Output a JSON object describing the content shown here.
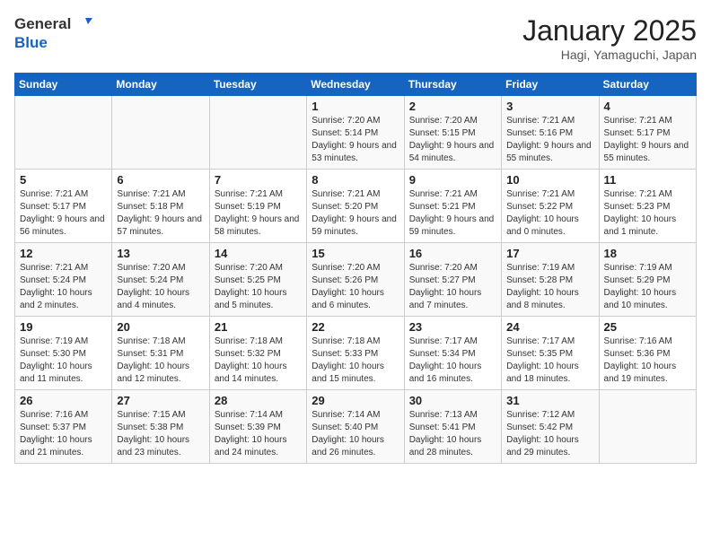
{
  "header": {
    "logo_line1": "General",
    "logo_line2": "Blue",
    "title": "January 2025",
    "subtitle": "Hagi, Yamaguchi, Japan"
  },
  "days_of_week": [
    "Sunday",
    "Monday",
    "Tuesday",
    "Wednesday",
    "Thursday",
    "Friday",
    "Saturday"
  ],
  "weeks": [
    [
      {
        "day": "",
        "info": ""
      },
      {
        "day": "",
        "info": ""
      },
      {
        "day": "",
        "info": ""
      },
      {
        "day": "1",
        "info": "Sunrise: 7:20 AM\nSunset: 5:14 PM\nDaylight: 9 hours and 53 minutes."
      },
      {
        "day": "2",
        "info": "Sunrise: 7:20 AM\nSunset: 5:15 PM\nDaylight: 9 hours and 54 minutes."
      },
      {
        "day": "3",
        "info": "Sunrise: 7:21 AM\nSunset: 5:16 PM\nDaylight: 9 hours and 55 minutes."
      },
      {
        "day": "4",
        "info": "Sunrise: 7:21 AM\nSunset: 5:17 PM\nDaylight: 9 hours and 55 minutes."
      }
    ],
    [
      {
        "day": "5",
        "info": "Sunrise: 7:21 AM\nSunset: 5:17 PM\nDaylight: 9 hours and 56 minutes."
      },
      {
        "day": "6",
        "info": "Sunrise: 7:21 AM\nSunset: 5:18 PM\nDaylight: 9 hours and 57 minutes."
      },
      {
        "day": "7",
        "info": "Sunrise: 7:21 AM\nSunset: 5:19 PM\nDaylight: 9 hours and 58 minutes."
      },
      {
        "day": "8",
        "info": "Sunrise: 7:21 AM\nSunset: 5:20 PM\nDaylight: 9 hours and 59 minutes."
      },
      {
        "day": "9",
        "info": "Sunrise: 7:21 AM\nSunset: 5:21 PM\nDaylight: 9 hours and 59 minutes."
      },
      {
        "day": "10",
        "info": "Sunrise: 7:21 AM\nSunset: 5:22 PM\nDaylight: 10 hours and 0 minutes."
      },
      {
        "day": "11",
        "info": "Sunrise: 7:21 AM\nSunset: 5:23 PM\nDaylight: 10 hours and 1 minute."
      }
    ],
    [
      {
        "day": "12",
        "info": "Sunrise: 7:21 AM\nSunset: 5:24 PM\nDaylight: 10 hours and 2 minutes."
      },
      {
        "day": "13",
        "info": "Sunrise: 7:20 AM\nSunset: 5:24 PM\nDaylight: 10 hours and 4 minutes."
      },
      {
        "day": "14",
        "info": "Sunrise: 7:20 AM\nSunset: 5:25 PM\nDaylight: 10 hours and 5 minutes."
      },
      {
        "day": "15",
        "info": "Sunrise: 7:20 AM\nSunset: 5:26 PM\nDaylight: 10 hours and 6 minutes."
      },
      {
        "day": "16",
        "info": "Sunrise: 7:20 AM\nSunset: 5:27 PM\nDaylight: 10 hours and 7 minutes."
      },
      {
        "day": "17",
        "info": "Sunrise: 7:19 AM\nSunset: 5:28 PM\nDaylight: 10 hours and 8 minutes."
      },
      {
        "day": "18",
        "info": "Sunrise: 7:19 AM\nSunset: 5:29 PM\nDaylight: 10 hours and 10 minutes."
      }
    ],
    [
      {
        "day": "19",
        "info": "Sunrise: 7:19 AM\nSunset: 5:30 PM\nDaylight: 10 hours and 11 minutes."
      },
      {
        "day": "20",
        "info": "Sunrise: 7:18 AM\nSunset: 5:31 PM\nDaylight: 10 hours and 12 minutes."
      },
      {
        "day": "21",
        "info": "Sunrise: 7:18 AM\nSunset: 5:32 PM\nDaylight: 10 hours and 14 minutes."
      },
      {
        "day": "22",
        "info": "Sunrise: 7:18 AM\nSunset: 5:33 PM\nDaylight: 10 hours and 15 minutes."
      },
      {
        "day": "23",
        "info": "Sunrise: 7:17 AM\nSunset: 5:34 PM\nDaylight: 10 hours and 16 minutes."
      },
      {
        "day": "24",
        "info": "Sunrise: 7:17 AM\nSunset: 5:35 PM\nDaylight: 10 hours and 18 minutes."
      },
      {
        "day": "25",
        "info": "Sunrise: 7:16 AM\nSunset: 5:36 PM\nDaylight: 10 hours and 19 minutes."
      }
    ],
    [
      {
        "day": "26",
        "info": "Sunrise: 7:16 AM\nSunset: 5:37 PM\nDaylight: 10 hours and 21 minutes."
      },
      {
        "day": "27",
        "info": "Sunrise: 7:15 AM\nSunset: 5:38 PM\nDaylight: 10 hours and 23 minutes."
      },
      {
        "day": "28",
        "info": "Sunrise: 7:14 AM\nSunset: 5:39 PM\nDaylight: 10 hours and 24 minutes."
      },
      {
        "day": "29",
        "info": "Sunrise: 7:14 AM\nSunset: 5:40 PM\nDaylight: 10 hours and 26 minutes."
      },
      {
        "day": "30",
        "info": "Sunrise: 7:13 AM\nSunset: 5:41 PM\nDaylight: 10 hours and 28 minutes."
      },
      {
        "day": "31",
        "info": "Sunrise: 7:12 AM\nSunset: 5:42 PM\nDaylight: 10 hours and 29 minutes."
      },
      {
        "day": "",
        "info": ""
      }
    ]
  ]
}
